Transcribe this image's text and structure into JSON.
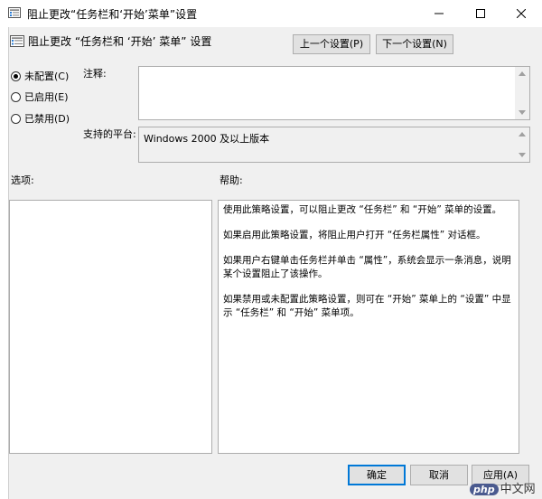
{
  "window": {
    "title": "阻止更改“任务栏和‘开始’菜单”设置",
    "minimize_icon": "minimize-icon",
    "maximize_icon": "maximize-icon",
    "close_icon": "close-icon"
  },
  "background_window": {
    "chars": [
      "",
      "",
      "",
      "",
      "",
      "",
      "",
      "",
      "",
      "",
      "",
      "",
      "",
      "",
      "",
      "",
      "",
      "",
      "",
      "",
      ""
    ]
  },
  "header": {
    "policy_name": "阻止更改 “任务栏和 ‘开始’ 菜单” 设置",
    "prev_button": "上一个设置(P)",
    "next_button": "下一个设置(N)"
  },
  "state": {
    "options": [
      {
        "label": "未配置(C)",
        "checked": true
      },
      {
        "label": "已启用(E)",
        "checked": false
      },
      {
        "label": "已禁用(D)",
        "checked": false
      }
    ]
  },
  "comment": {
    "label": "注释:",
    "value": ""
  },
  "supported": {
    "label": "支持的平台:",
    "value": "Windows 2000 及以上版本"
  },
  "options_panel": {
    "label": "选项:"
  },
  "help_panel": {
    "label": "帮助:",
    "paragraphs": [
      "使用此策略设置，可以阻止更改 “任务栏” 和 “开始” 菜单的设置。",
      "如果启用此策略设置，将阻止用户打开 “任务栏属性” 对话框。",
      "如果用户右键单击任务栏并单击 “属性”，系统会显示一条消息，说明某个设置阻止了该操作。",
      "如果禁用或未配置此策略设置，则可在 “开始” 菜单上的 “设置” 中显示 “任务栏” 和 “开始” 菜单项。"
    ]
  },
  "footer": {
    "ok": "确定",
    "cancel": "取消",
    "apply": "应用(A)"
  },
  "watermark": {
    "logo": "php",
    "text": "中文网"
  },
  "colors": {
    "accent": "#0078d7",
    "dialog_bg": "#f0f0f0",
    "border": "#adadad"
  }
}
